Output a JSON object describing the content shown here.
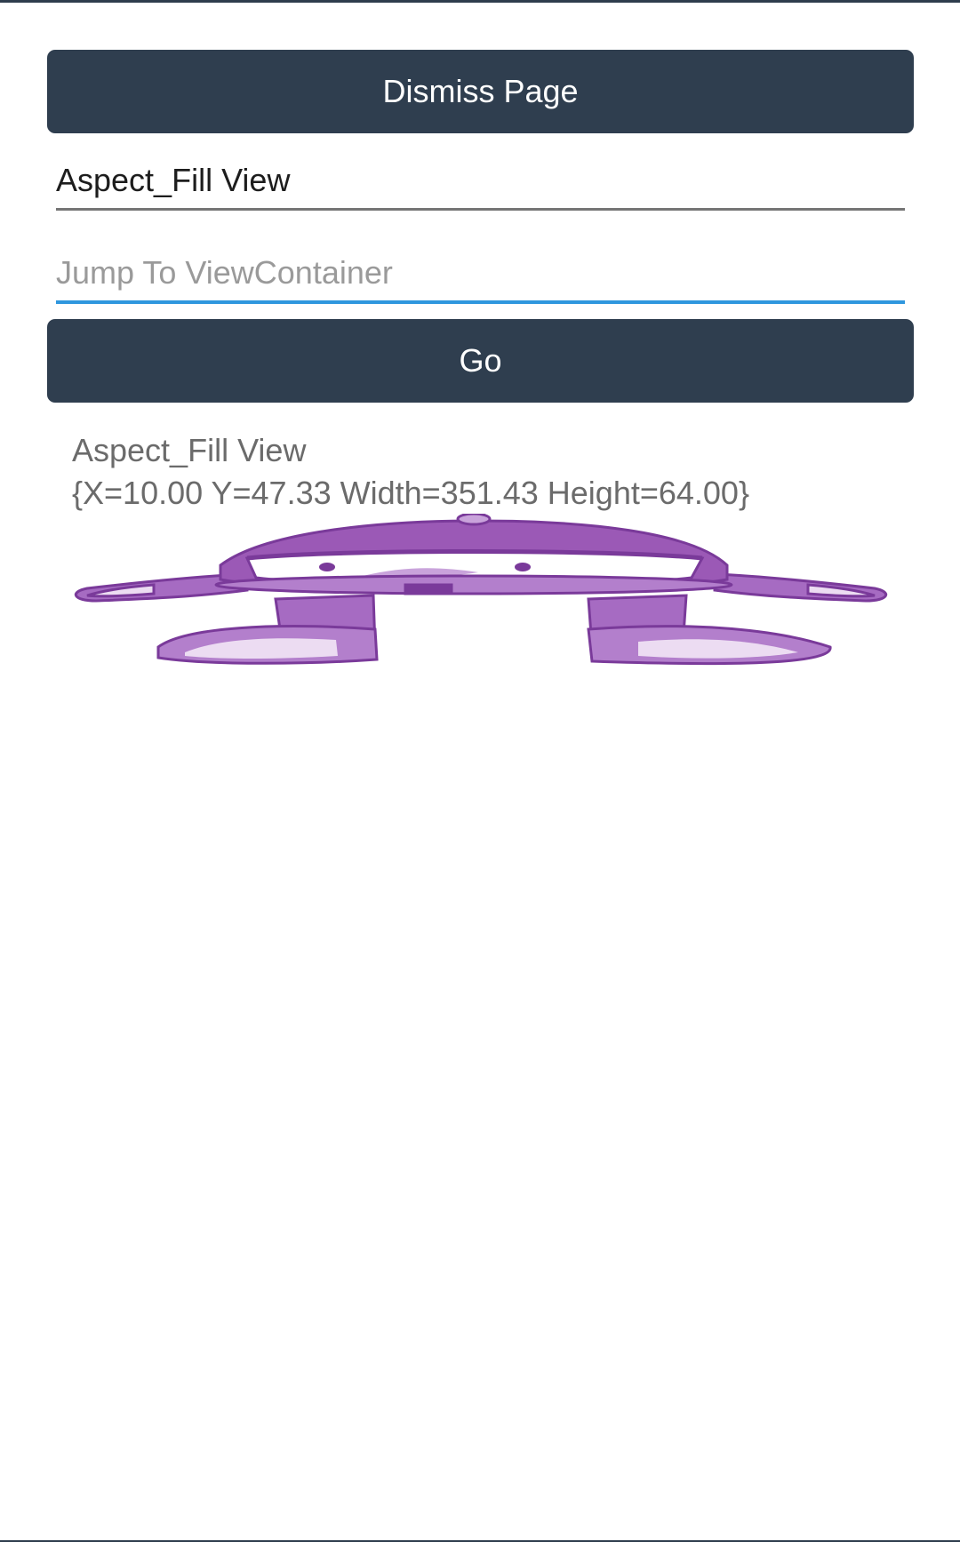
{
  "buttons": {
    "dismiss_label": "Dismiss Page",
    "go_label": "Go"
  },
  "fields": {
    "view_name_value": "Aspect_Fill View",
    "jump_placeholder": "Jump To ViewContainer"
  },
  "info": {
    "title": "Aspect_Fill View",
    "rect": "{X=10.00 Y=47.33 Width=351.43 Height=64.00}"
  },
  "image": {
    "icon": "robot-mascot-image",
    "primary_color": "#9b59b6",
    "light_color": "#ecdcf2",
    "outline_color": "#7a3a9a"
  },
  "colors": {
    "button_bg": "#2f3e4f",
    "focus_underline": "#2f97de"
  }
}
